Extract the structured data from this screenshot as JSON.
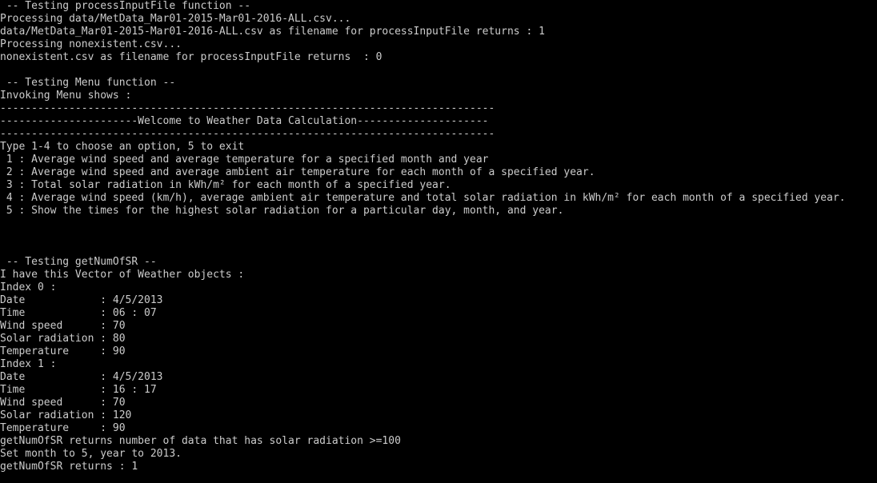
{
  "console": {
    "text_color": "#cccccc",
    "background_color": "#000000",
    "lines": [
      " -- Testing processInputFile function --",
      "Processing data/MetData_Mar01-2015-Mar01-2016-ALL.csv...",
      "data/MetData_Mar01-2015-Mar01-2016-ALL.csv as filename for processInputFile returns : 1",
      "Processing nonexistent.csv...",
      "nonexistent.csv as filename for processInputFile returns  : 0",
      "",
      " -- Testing Menu function --",
      "Invoking Menu shows :",
      "-------------------------------------------------------------------------------",
      "----------------------Welcome to Weather Data Calculation---------------------",
      "-------------------------------------------------------------------------------",
      "Type 1-4 to choose an option, 5 to exit",
      " 1 : Average wind speed and average temperature for a specified month and year",
      " 2 : Average wind speed and average ambient air temperature for each month of a specified year.",
      " 3 : Total solar radiation in kWh/m² for each month of a specified year.",
      " 4 : Average wind speed (km/h), average ambient air temperature and total solar radiation in kWh/m² for each month of a specified year.",
      " 5 : Show the times for the highest solar radiation for a particular day, month, and year.",
      "",
      "",
      "",
      " -- Testing getNumOfSR --",
      "I have this Vector of Weather objects :",
      "Index 0 :",
      "Date            : 4/5/2013",
      "Time            : 06 : 07",
      "Wind speed      : 70",
      "Solar radiation : 80",
      "Temperature     : 90",
      "Index 1 :",
      "Date            : 4/5/2013",
      "Time            : 16 : 17",
      "Wind speed      : 70",
      "Solar radiation : 120",
      "Temperature     : 90",
      "getNumOfSR returns number of data that has solar radiation >=100",
      "Set month to 5, year to 2013.",
      "getNumOfSR returns : 1"
    ]
  }
}
